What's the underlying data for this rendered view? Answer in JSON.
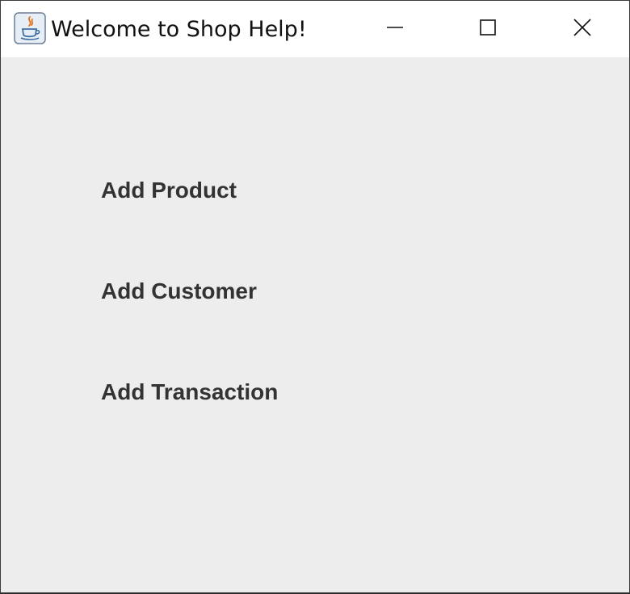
{
  "window": {
    "title": "Welcome to Shop Help!",
    "app_icon": "java-cup-icon",
    "controls": {
      "minimize_icon": "minimize-icon",
      "maximize_icon": "maximize-icon",
      "close_icon": "close-icon"
    }
  },
  "menu": {
    "items": [
      {
        "label": "Add Product"
      },
      {
        "label": "Add Customer"
      },
      {
        "label": "Add Transaction"
      }
    ]
  },
  "colors": {
    "titlebar_bg": "#ffffff",
    "content_bg": "#ededed",
    "label_text": "#333333"
  }
}
